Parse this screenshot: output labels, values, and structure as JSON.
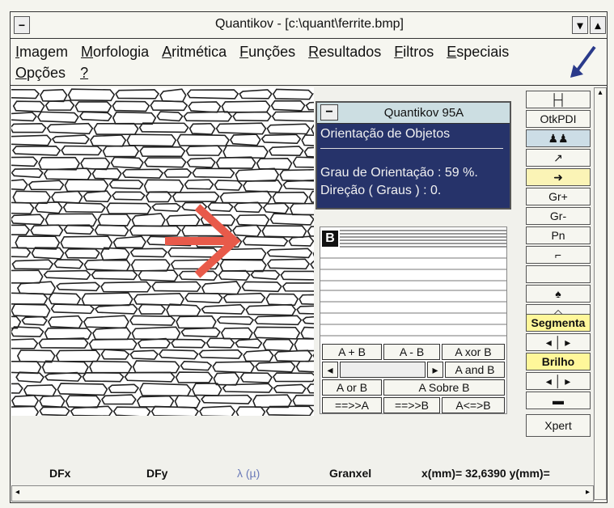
{
  "window": {
    "title": "Quantikov - [c:\\quant\\ferrite.bmp]"
  },
  "menu": [
    {
      "underline": "I",
      "rest": "magem"
    },
    {
      "underline": "M",
      "rest": "orfologia"
    },
    {
      "underline": "A",
      "rest": "ritmética"
    },
    {
      "underline": "F",
      "rest": "unções"
    },
    {
      "underline": "R",
      "rest": "esultados"
    },
    {
      "underline": "F",
      "rest": "iltros"
    },
    {
      "underline": "E",
      "rest": "speciais"
    }
  ],
  "menu2": [
    {
      "underline": "O",
      "rest": "pções"
    },
    {
      "underline": "?",
      "rest": ""
    }
  ],
  "dialog": {
    "title": "Quantikov 95A",
    "heading": "Orientação de Objetos",
    "line1": "Grau de Orientação :  59 %.",
    "line2": "Direção ( Graus ) :  0."
  },
  "panel": {
    "b_label": "B",
    "row1": [
      "A + B",
      "A - B",
      "A xor B"
    ],
    "row2": "A and B",
    "row3": [
      "A or B",
      "A Sobre B"
    ],
    "row4": [
      "==>>A",
      "==>>B",
      "A<=>B"
    ]
  },
  "toolbar": {
    "otkpdi": "OtkPDI",
    "gr_plus": "Gr+",
    "gr_minus": "Gr-",
    "pn": "Pn",
    "segmenta": "Segmenta",
    "brilho": "Brilho",
    "xpert": "Xpert"
  },
  "status": {
    "dfx": "DFx",
    "dfy": "DFy",
    "lambda": "λ (µ)",
    "granxel": "Granxel",
    "coords": "x(mm)= 32,6390 y(mm)="
  },
  "colors": {
    "dialog_bg": "#26336a",
    "arrow_red": "#e85a4a",
    "arrow_blue": "#2a3a8a",
    "highlight_yellow": "#fff79a"
  }
}
